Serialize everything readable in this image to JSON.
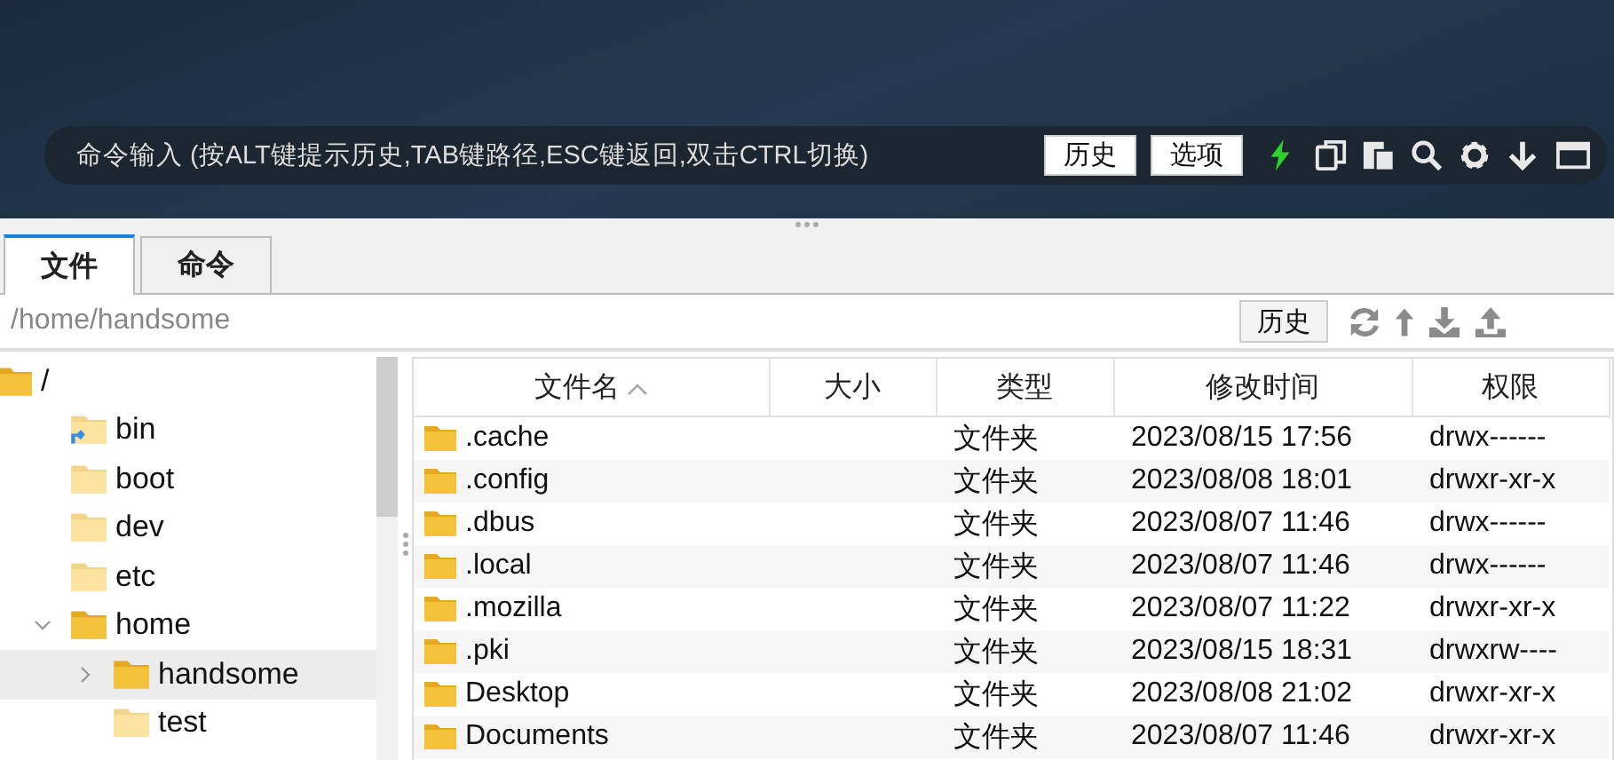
{
  "command_bar": {
    "placeholder": "命令输入 (按ALT键提示历史,TAB键路径,ESC键返回,双击CTRL切换)",
    "buttons": [
      "历史",
      "选项"
    ]
  },
  "tabs": [
    {
      "label": "文件",
      "selected": true
    },
    {
      "label": "命令",
      "selected": false
    }
  ],
  "path_bar": {
    "value": "/home/handsome",
    "button": "历史"
  },
  "tree": [
    {
      "label": "/",
      "kind": "folder",
      "expanded": true,
      "selected": false,
      "children": [
        {
          "label": "bin",
          "kind": "link",
          "selected": false
        },
        {
          "label": "boot",
          "kind": "folder",
          "selected": false
        },
        {
          "label": "dev",
          "kind": "folder",
          "selected": false
        },
        {
          "label": "etc",
          "kind": "folder",
          "selected": false
        },
        {
          "label": "home",
          "kind": "folder",
          "expanded": true,
          "selected": false,
          "children": [
            {
              "label": "handsome",
              "kind": "folder",
              "expanded": false,
              "selected": true
            },
            {
              "label": "test",
              "kind": "folder",
              "selected": false
            }
          ]
        }
      ]
    }
  ],
  "table": {
    "columns": [
      {
        "label": "文件名",
        "sorted": true
      },
      {
        "label": "大小",
        "sorted": false
      },
      {
        "label": "类型",
        "sorted": false
      },
      {
        "label": "修改时间",
        "sorted": false
      },
      {
        "label": "权限",
        "sorted": false
      }
    ],
    "rows": [
      [
        ".cache",
        "",
        "文件夹",
        "2023/08/15 17:56",
        "drwx------"
      ],
      [
        ".config",
        "",
        "文件夹",
        "2023/08/08 18:01",
        "drwxr-xr-x"
      ],
      [
        ".dbus",
        "",
        "文件夹",
        "2023/08/07 11:46",
        "drwx------"
      ],
      [
        ".local",
        "",
        "文件夹",
        "2023/08/07 11:46",
        "drwx------"
      ],
      [
        ".mozilla",
        "",
        "文件夹",
        "2023/08/07 11:22",
        "drwxr-xr-x"
      ],
      [
        ".pki",
        "",
        "文件夹",
        "2023/08/15 18:31",
        "drwxrw----"
      ],
      [
        "Desktop",
        "",
        "文件夹",
        "2023/08/08 21:02",
        "drwxr-xr-x"
      ],
      [
        "Documents",
        "",
        "文件夹",
        "2023/08/07 11:46",
        "drwxr-xr-x"
      ]
    ]
  }
}
